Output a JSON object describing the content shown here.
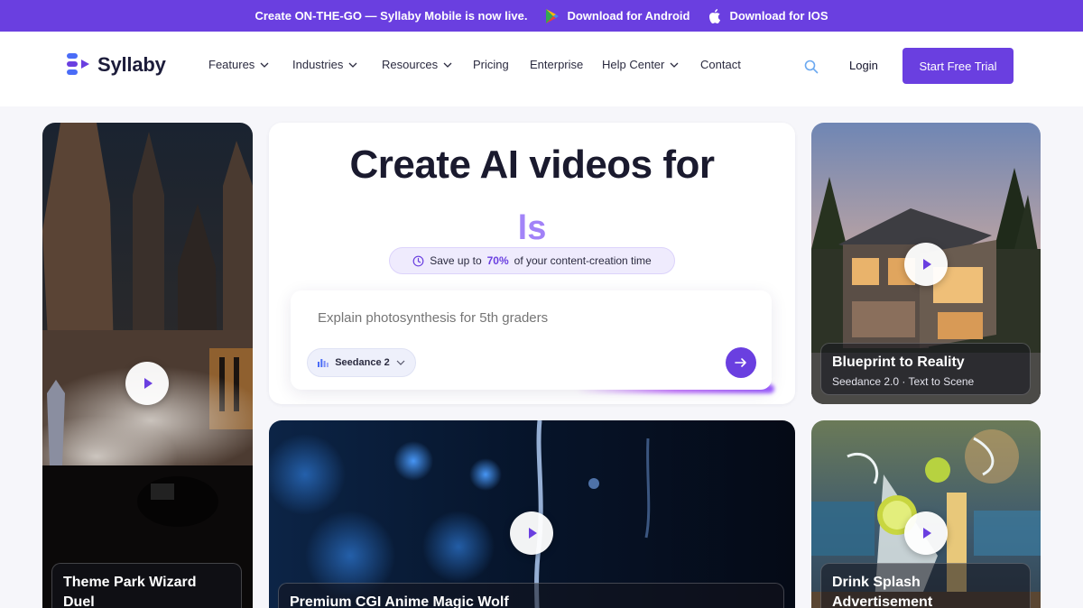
{
  "announcement": {
    "text": "Create ON-THE-GO — Syllaby Mobile is now live.",
    "android": "Download for Android",
    "ios": "Download for IOS"
  },
  "brand": {
    "name": "Syllaby",
    "accent": "#6a3fe0"
  },
  "nav": {
    "items": [
      {
        "label": "Features",
        "dropdown": true
      },
      {
        "label": "Industries",
        "dropdown": true
      },
      {
        "label": "Resources",
        "dropdown": true
      },
      {
        "label": "Pricing",
        "dropdown": false
      },
      {
        "label": "Enterprise",
        "dropdown": false
      },
      {
        "label": "Help Center",
        "dropdown": true
      },
      {
        "label": "Contact",
        "dropdown": false
      }
    ],
    "login": "Login",
    "cta": "Start Free Trial"
  },
  "hero": {
    "title": "Create AI videos for",
    "rotating_word": "ls",
    "save_prefix": "Save up to",
    "save_pct": "70%",
    "save_suffix": "of your content-creation time",
    "prompt_placeholder": "Explain photosynthesis for 5th graders",
    "model": "Seedance 2"
  },
  "cards": [
    {
      "title": "Theme Park Wizard Duel",
      "subtitle": ""
    },
    {
      "title": "Blueprint to Reality",
      "subtitle": "Seedance 2.0 · Text to Scene"
    },
    {
      "title": "Premium CGI Anime Magic Wolf",
      "subtitle": ""
    },
    {
      "title": "Drink Splash Advertisement",
      "subtitle": ""
    }
  ]
}
